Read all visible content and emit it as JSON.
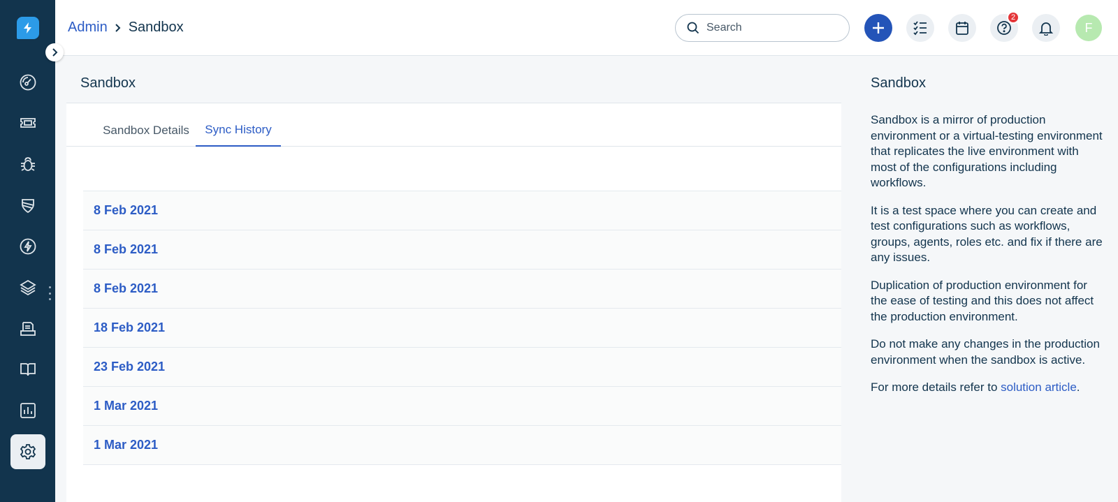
{
  "sidebar": {
    "logo_icon": "bolt-logo-icon",
    "items": [
      {
        "name": "dashboard",
        "icon": "speedometer-icon"
      },
      {
        "name": "tickets",
        "icon": "ticket-icon"
      },
      {
        "name": "problems",
        "icon": "bug-icon"
      },
      {
        "name": "changes",
        "icon": "shield-icon"
      },
      {
        "name": "releases",
        "icon": "bolt-icon"
      },
      {
        "name": "assets",
        "icon": "layers-icon"
      },
      {
        "name": "purchase-orders",
        "icon": "document-icon"
      },
      {
        "name": "solutions",
        "icon": "book-icon"
      },
      {
        "name": "reports",
        "icon": "chart-icon"
      },
      {
        "name": "admin",
        "icon": "gear-icon",
        "active": true
      }
    ]
  },
  "header": {
    "breadcrumb": {
      "parent": "Admin",
      "current": "Sandbox"
    },
    "search_placeholder": "Search",
    "help_badge": "2",
    "avatar_initial": "F"
  },
  "main": {
    "title": "Sandbox",
    "tabs": [
      {
        "label": "Sandbox Details",
        "active": false
      },
      {
        "label": "Sync History",
        "active": true
      }
    ],
    "sync_dates": [
      "8 Feb 2021",
      "8 Feb 2021",
      "8 Feb 2021",
      "18 Feb 2021",
      "23 Feb 2021",
      "1 Mar 2021",
      "1 Mar 2021"
    ]
  },
  "info": {
    "title": "Sandbox",
    "para1": "Sandbox is a mirror of production environment or a virtual-testing environment that replicates the live environment with most of the configurations including workflows.",
    "para2": "It is a test space where you can create and test configurations such as workflows, groups, agents, roles etc. and fix if there are any issues.",
    "para3": "Duplication of production environment for the ease of testing and this does not affect the production environment.",
    "para4": "Do not make any changes in the production environment when the sandbox is active.",
    "para5_prefix": "For more details refer to ",
    "para5_link": "solution article",
    "para5_suffix": "."
  },
  "colors": {
    "sidebar_bg": "#12344d",
    "accent": "#2c5cc5",
    "primary_button": "#2454b8",
    "badge": "#e43538",
    "avatar": "#b7e9b0"
  }
}
